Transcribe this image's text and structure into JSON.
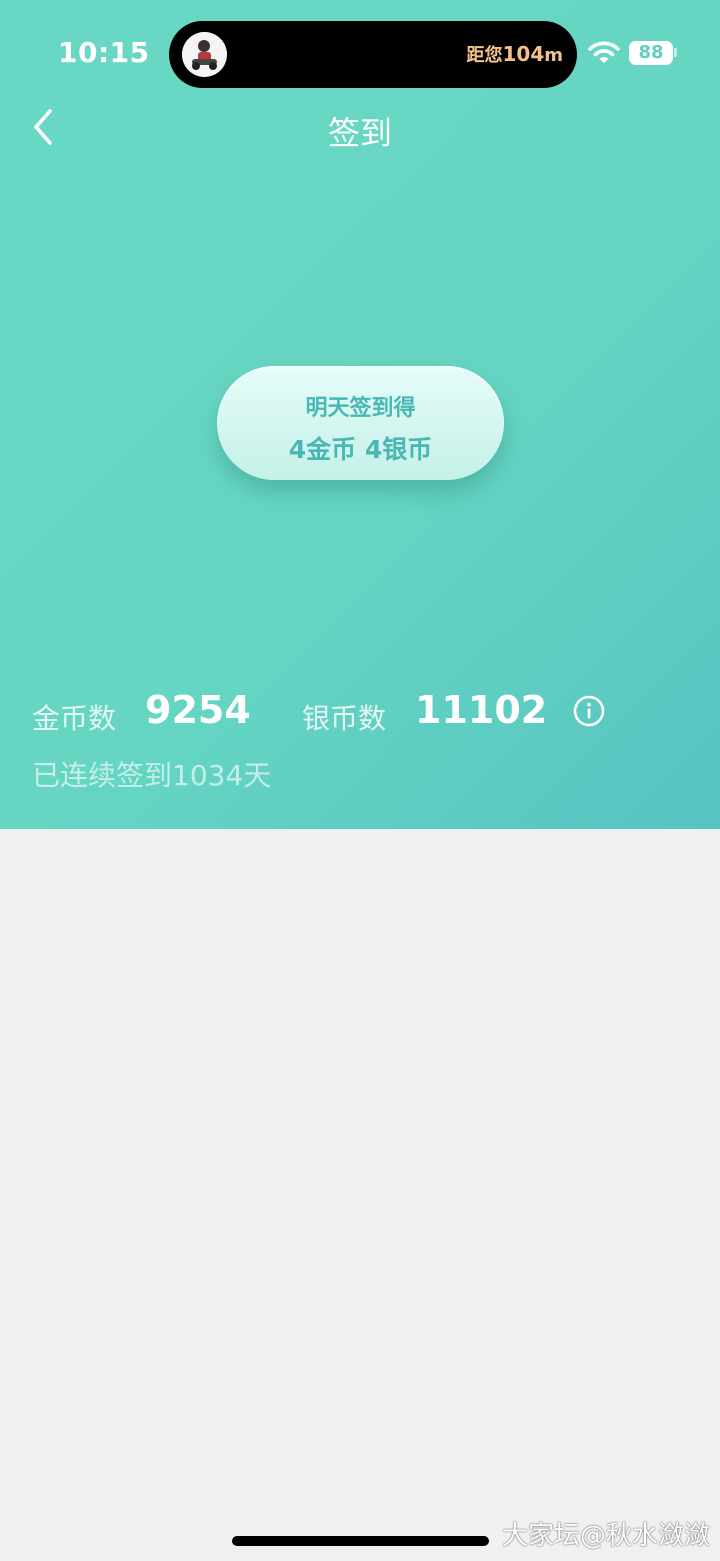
{
  "status_bar": {
    "time": "10:15",
    "island_distance_prefix": "距您",
    "island_distance_value": "104",
    "island_distance_unit": "m",
    "battery_text": "88",
    "battery_percent": 88,
    "wifi_icon": "wifi-icon",
    "avatar_icon": "avatar-icon"
  },
  "nav": {
    "title": "签到",
    "back_icon": "chevron-left-icon"
  },
  "signin_pill": {
    "line1": "明天签到得",
    "line2": "4金币 4银币"
  },
  "stats": {
    "gold_label": "金币数",
    "gold_value": "9254",
    "silver_label": "银币数",
    "silver_value": "11102",
    "info_icon": "info-icon",
    "streak_text": "已连续签到1034天"
  },
  "watermark": "大家坛@秋水潋潋",
  "colors": {
    "hero_start": "#68d8c4",
    "hero_end": "#56c4c1",
    "pill_text": "#49b7b4",
    "island_text": "#f3c28c",
    "page_bg": "#eef0f2"
  }
}
